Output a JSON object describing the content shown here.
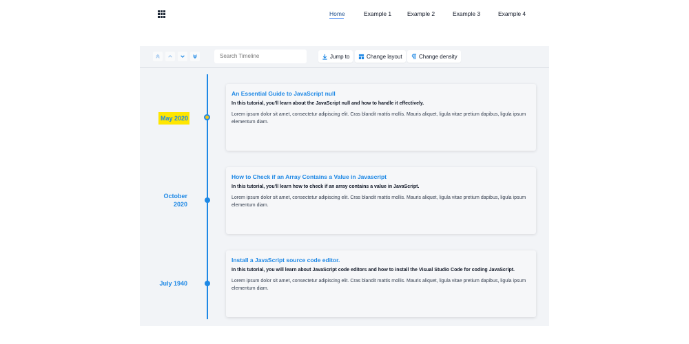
{
  "nav": {
    "menu_icon": "grid-menu-icon",
    "items": [
      {
        "label": "Home",
        "active": true
      },
      {
        "label": "Example 1"
      },
      {
        "label": "Example 2"
      },
      {
        "label": "Example 3"
      },
      {
        "label": "Example 4"
      }
    ],
    "active_color": "#3b82f6"
  },
  "toolbar": {
    "buttons": [
      {
        "icon": "double-chevron-up-icon"
      },
      {
        "icon": "chevron-up-icon"
      },
      {
        "icon": "chevron-down-icon"
      },
      {
        "icon": "double-chevron-down-icon"
      }
    ],
    "search_placeholder": "Search Timeline",
    "jump_label": "Jump to",
    "jump_icon": "download-arrow-icon",
    "layout_label": "Change layout",
    "layout_icon": "layout-icon",
    "density_label": "Change density",
    "density_icon": "paragraph-icon"
  },
  "timeline": {
    "accent": "#1e88e5",
    "highlight": "#ffe600",
    "items": [
      {
        "date": "May 2020",
        "active": true,
        "title": "An Essential Guide to JavaScript null",
        "subtitle": "In this tutorial, you'll learn about the JavaScript null and how to handle it effectively.",
        "body": "Lorem ipsum dolor sit amet, consectetur adipiscing elit. Cras blandit mattis mollis. Mauris aliquet, ligula vitae pretium dapibus, ligula ipsum elementum diam."
      },
      {
        "date": "October 2020",
        "title": "How to Check if an Array Contains a Value in Javascript",
        "subtitle": "In this tutorial, you'll learn how to check if an array contains a value in JavaScript.",
        "body": "Lorem ipsum dolor sit amet, consectetur adipiscing elit. Cras blandit mattis mollis. Mauris aliquet, ligula vitae pretium dapibus, ligula ipsum elementum diam."
      },
      {
        "date": "July 1940",
        "title": "Install a JavaScript source code editor.",
        "subtitle": "In this tutorial, you will learn about JavaScript code editors and how to install the Visual Studio Code for coding JavaScript.",
        "body": "Lorem ipsum dolor sit amet, consectetur adipiscing elit. Cras blandit mattis mollis. Mauris aliquet, ligula vitae pretium dapibus, ligula ipsum elementum diam."
      }
    ]
  }
}
